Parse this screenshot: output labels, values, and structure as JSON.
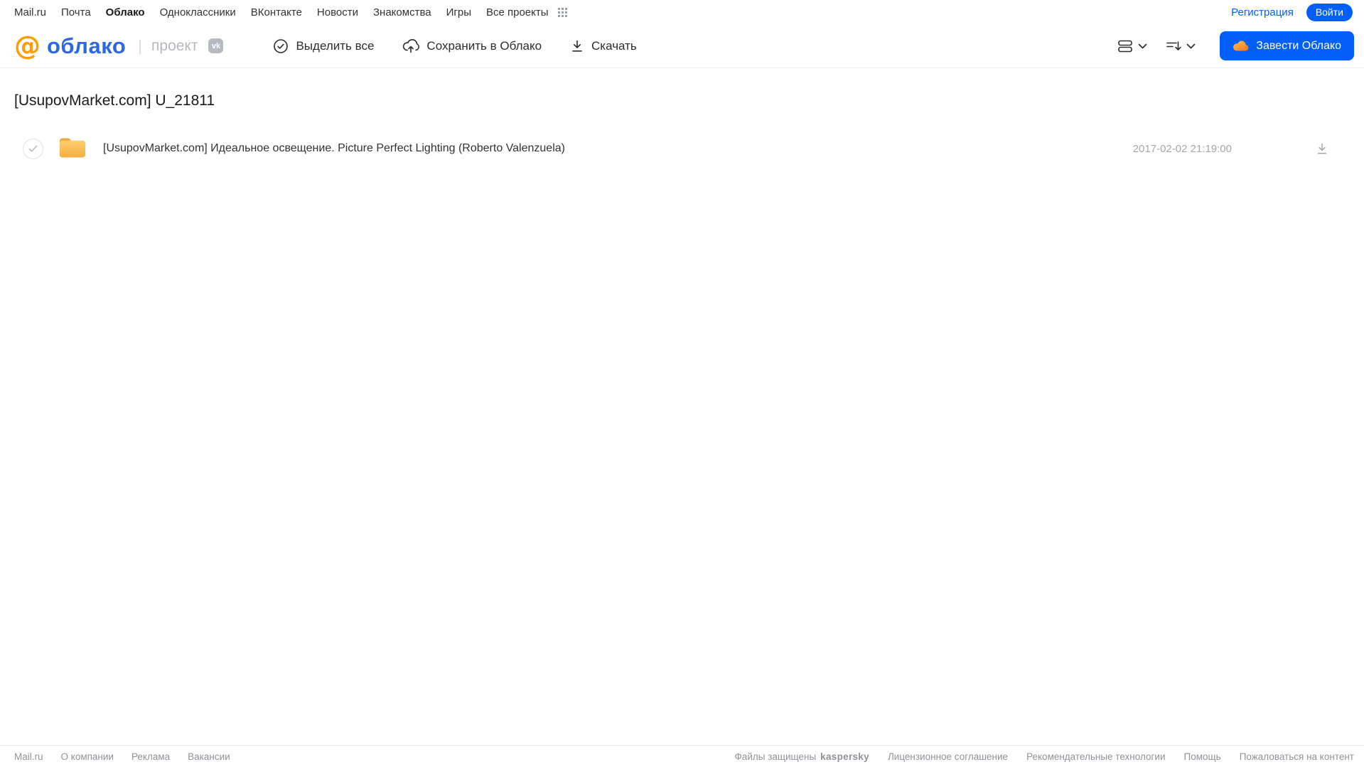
{
  "colors": {
    "accent": "#005ff9",
    "logo_orange": "#ff9e00",
    "logo_blue": "#2d68e0",
    "folder_top": "#fccf6d",
    "folder_bottom": "#f6ae42",
    "kaspersky_green": "#00a88e"
  },
  "topnav": {
    "items": [
      "Mail.ru",
      "Почта",
      "Облако",
      "Одноклассники",
      "ВКонтакте",
      "Новости",
      "Знакомства",
      "Игры",
      "Все проекты"
    ],
    "registration": "Регистрация",
    "login": "Войти"
  },
  "header": {
    "logo_at": "@",
    "logo_text": "облако",
    "divider": "|",
    "project_label": "проект",
    "vk_badge": "vk",
    "toolbar": {
      "select_all": "Выделить все",
      "save_to_cloud": "Сохранить в Облако",
      "download": "Скачать",
      "create_cloud": "Завести Облако"
    }
  },
  "main": {
    "title": "[UsupovMarket.com] U_21811",
    "file": {
      "name": "[UsupovMarket.com] Идеальное освещение. Picture Perfect Lighting (Roberto Valenzuela)",
      "date": "2017-02-02 21:19:00"
    }
  },
  "footer": {
    "left": [
      "Mail.ru",
      "О компании",
      "Реклама",
      "Вакансии"
    ],
    "protected_label": "Файлы защищены",
    "kaspersky": "kaspersky",
    "right": [
      "Лицензионное соглашение",
      "Рекомендательные технологии",
      "Помощь",
      "Пожаловаться на контент"
    ]
  }
}
